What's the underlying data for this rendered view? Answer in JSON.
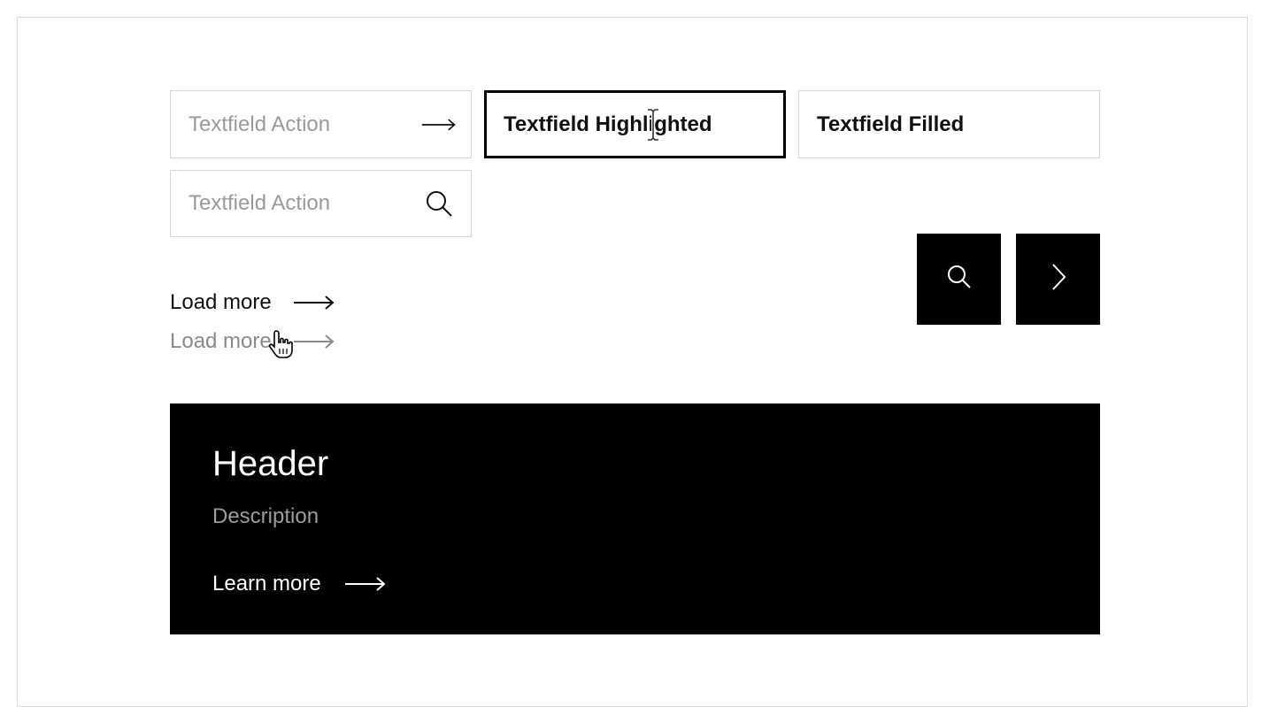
{
  "textfields": {
    "action_arrow": {
      "placeholder": "Textfield Action",
      "icon": "arrow-right-icon"
    },
    "highlighted": {
      "value": "Textfield Highlighted"
    },
    "filled": {
      "value": "Textfield Filled"
    },
    "action_search": {
      "placeholder": "Textfield Action",
      "icon": "search-icon"
    }
  },
  "icon_buttons": [
    {
      "icon": "search-icon"
    },
    {
      "icon": "chevron-right-icon"
    }
  ],
  "links": {
    "load_more_default": "Load more",
    "load_more_hover": "Load more"
  },
  "hero": {
    "header": "Header",
    "description": "Description",
    "cta": "Learn more"
  },
  "colors": {
    "primary": "#000000",
    "placeholder": "#9a9a9a",
    "border": "#d6d6d6",
    "muted": "#8a8a8a"
  }
}
